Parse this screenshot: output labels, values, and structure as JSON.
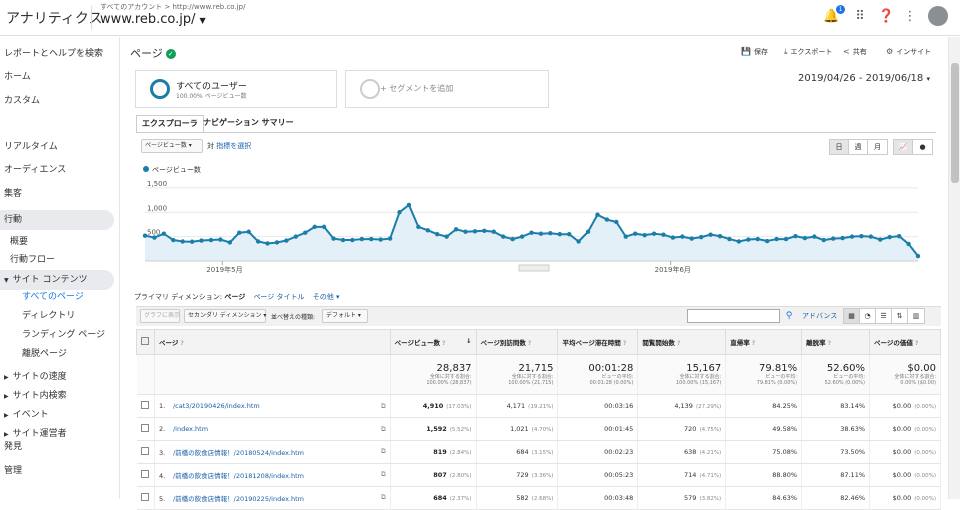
{
  "header": {
    "app_title": "アナリティクス",
    "account_line": "すべてのアカウント > http://www.reb.co.jp/",
    "property": "www.reb.co.jp/",
    "notification_count": "1"
  },
  "sidebar": {
    "search": "レポートとヘルプを検索",
    "home": "ホーム",
    "custom": "カスタム",
    "realtime": "リアルタイム",
    "audience": "オーディエンス",
    "acquisition": "集客",
    "behavior": "行動",
    "overview": "概要",
    "behavior_flow": "行動フロー",
    "site_content": "サイト コンテンツ",
    "all_pages": "すべてのページ",
    "directory": "ディレクトリ",
    "landing_pages": "ランディング ページ",
    "exit_pages": "離脱ページ",
    "site_speed": "サイトの速度",
    "site_search": "サイト内検索",
    "events": "イベント",
    "publisher": "サイト運営者",
    "discover": "発見",
    "admin": "管理"
  },
  "page": {
    "title": "ページ",
    "actions": {
      "save": "保存",
      "export": "エクスポート",
      "share": "共有",
      "insight": "インサイト"
    },
    "segment_all_title": "すべてのユーザー",
    "segment_all_sub": "100.00% ページビュー数",
    "segment_add": "+ セグメントを追加",
    "date_range": "2019/04/26 - 2019/06/18"
  },
  "tabs": [
    "エクスプローラ",
    "ナビゲーション サマリー"
  ],
  "chart_controls": {
    "metric_select": "ページビュー数",
    "vs": "対",
    "select_metric": "指標を選択",
    "day": "日",
    "week": "週",
    "month": "月"
  },
  "chart_data": {
    "type": "line",
    "series": [
      {
        "name": "ページビュー数",
        "values": [
          520,
          480,
          560,
          430,
          400,
          395,
          420,
          430,
          440,
          380,
          580,
          600,
          400,
          360,
          380,
          420,
          500,
          580,
          700,
          700,
          460,
          430,
          430,
          450,
          450,
          440,
          460,
          1000,
          1150,
          700,
          630,
          550,
          500,
          650,
          600,
          610,
          620,
          600,
          500,
          450,
          500,
          580,
          560,
          570,
          550,
          550,
          400,
          600,
          950,
          850,
          800,
          500,
          560,
          530,
          560,
          540,
          480,
          500,
          460,
          490,
          540,
          510,
          450,
          400,
          440,
          450,
          410,
          450,
          450,
          510,
          470,
          500,
          430,
          460,
          470,
          500,
          510,
          500,
          440,
          490,
          510,
          350,
          100
        ]
      }
    ],
    "y_ticks": [
      "1,500",
      "1,000",
      "500"
    ],
    "ylim": [
      0,
      1600
    ],
    "x_labels": [
      "2019年5月",
      "2019年6月"
    ],
    "color": "#1a7ea8"
  },
  "primary_dimension": {
    "label": "プライマリ ディメンション:",
    "options": [
      "ページ",
      "ページ タイトル",
      "その他"
    ]
  },
  "filter_row": {
    "plot_rows": "グラフに表示",
    "secondary_dim": "セカンダリ ディメンション",
    "sort_type": "並べ替えの種類:",
    "sort_value": "デフォルト",
    "advanced": "アドバンス"
  },
  "table": {
    "columns": [
      "ページ",
      "ページビュー数",
      "ページ別訪問数",
      "平均ページ滞在時間",
      "閲覧開始数",
      "直帰率",
      "離脱率",
      "ページの価値"
    ],
    "totals": [
      {
        "value": "28,837",
        "sub1": "全体に対する割合:",
        "sub2": "100.00% (28,837)"
      },
      {
        "value": "21,715",
        "sub1": "全体に対する割合:",
        "sub2": "100.00% (21,715)"
      },
      {
        "value": "00:01:28",
        "sub1": "ビューの平均:",
        "sub2": "00:01:28 (0.00%)"
      },
      {
        "value": "15,167",
        "sub1": "全体に対する割合:",
        "sub2": "100.00% (15,167)"
      },
      {
        "value": "79.81%",
        "sub1": "ビューの平均:",
        "sub2": "79.81% (0.00%)"
      },
      {
        "value": "52.60%",
        "sub1": "ビューの平均:",
        "sub2": "52.60% (0.00%)"
      },
      {
        "value": "$0.00",
        "sub1": "全体に対する割合:",
        "sub2": "0.00% ($0.00)"
      }
    ],
    "rows": [
      {
        "n": "1.",
        "page": "/cat3/20190426/index.htm",
        "pv": "4,910",
        "pv_pct": "(17.03%)",
        "upv": "4,171",
        "upv_pct": "(19.21%)",
        "time": "00:03:16",
        "ent": "4,139",
        "ent_pct": "(27.29%)",
        "bounce": "84.25%",
        "exit": "83.14%",
        "val": "$0.00",
        "val_pct": "(0.00%)"
      },
      {
        "n": "2.",
        "page": "/index.htm",
        "pv": "1,592",
        "pv_pct": "(5.52%)",
        "upv": "1,021",
        "upv_pct": "(4.70%)",
        "time": "00:01:45",
        "ent": "720",
        "ent_pct": "(4.75%)",
        "bounce": "49.58%",
        "exit": "38.63%",
        "val": "$0.00",
        "val_pct": "(0.00%)"
      },
      {
        "n": "3.",
        "page": "/前橋の飲食店情報！/20180524/index.htm",
        "pv": "819",
        "pv_pct": "(2.84%)",
        "upv": "684",
        "upv_pct": "(3.15%)",
        "time": "00:02:23",
        "ent": "638",
        "ent_pct": "(4.21%)",
        "bounce": "75.08%",
        "exit": "73.50%",
        "val": "$0.00",
        "val_pct": "(0.00%)"
      },
      {
        "n": "4.",
        "page": "/前橋の飲食店情報！/20181208/index.htm",
        "pv": "807",
        "pv_pct": "(2.80%)",
        "upv": "729",
        "upv_pct": "(3.36%)",
        "time": "00:05:23",
        "ent": "714",
        "ent_pct": "(4.71%)",
        "bounce": "88.80%",
        "exit": "87.11%",
        "val": "$0.00",
        "val_pct": "(0.00%)"
      },
      {
        "n": "5.",
        "page": "/前橋の飲食店情報！/20190225/index.htm",
        "pv": "684",
        "pv_pct": "(2.37%)",
        "upv": "582",
        "upv_pct": "(2.68%)",
        "time": "00:03:48",
        "ent": "579",
        "ent_pct": "(3.82%)",
        "bounce": "84.63%",
        "exit": "82.46%",
        "val": "$0.00",
        "val_pct": "(0.00%)"
      }
    ]
  }
}
